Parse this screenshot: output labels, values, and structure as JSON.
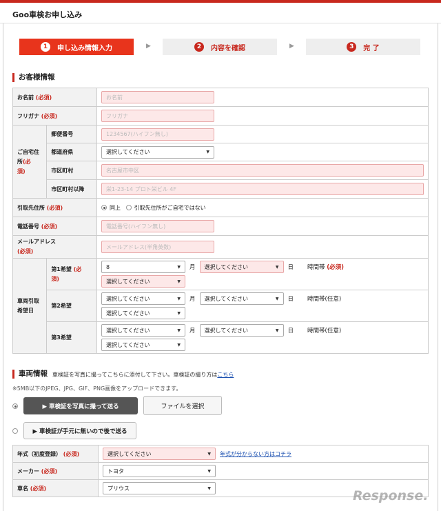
{
  "header": {
    "title": "Goo車検お申し込み"
  },
  "steps": [
    {
      "num": "1",
      "label": "申し込み情報入力"
    },
    {
      "num": "2",
      "label": "内容を確認"
    },
    {
      "num": "3",
      "label": "完 了"
    }
  ],
  "customer": {
    "section_title": "お客様情報",
    "required": "(必須)",
    "name": {
      "label": "お名前",
      "placeholder": "お名前"
    },
    "furigana": {
      "label": "フリガナ",
      "placeholder": "フリガナ"
    },
    "address": {
      "label": "ご自宅住所",
      "required_line1": "(必",
      "required_line2": "須)",
      "postal": {
        "label": "郵便番号",
        "placeholder": "1234567(ハイフン無し)"
      },
      "prefecture": {
        "label": "都道府県",
        "value": "選択してください"
      },
      "city": {
        "label": "市区町村",
        "placeholder": "名古屋市中区"
      },
      "street": {
        "label": "市区町村以降",
        "placeholder": "栄1-23-14 プロト栄ビル 4F"
      }
    },
    "pickup": {
      "label": "引取先住所",
      "option_same": "同上",
      "option_other": "引取先住所がご自宅ではない"
    },
    "phone": {
      "label": "電話番号",
      "placeholder": "電話番号(ハイフン無し)"
    },
    "email": {
      "label": "メールアドレス",
      "required": "(必須)",
      "placeholder": "メールアドレス(半角英数)"
    },
    "pickup_date": {
      "label_line1": "車両引取",
      "label_line2": "希望日",
      "month_unit": "月",
      "day_unit": "日",
      "first": {
        "label": "第1希望",
        "required_a": "(必",
        "required_b": "須)",
        "month": "8",
        "day": "選択してください",
        "time_label": "時間帯",
        "time_req": "(必須)",
        "time": "選択してください"
      },
      "second": {
        "label": "第2希望",
        "month": "選択してください",
        "day": "選択してください",
        "time_label": "時間帯(任意)",
        "time": "選択してください"
      },
      "third": {
        "label": "第3希望",
        "month": "選択してください",
        "day": "選択してください",
        "time_label": "時間帯(任意)",
        "time": "選択してください"
      }
    }
  },
  "vehicle": {
    "section_title": "車両情報",
    "description": "車検証を写真に撮ってこちらに添付して下さい。車検証の撮り方は",
    "description_link": "こちら",
    "note": "※5MB以下のJPEG、JPG、GIF、PNG画像をアップロードできます。",
    "photo_button": "▶ 車検証を写真に撮って送る",
    "file_button": "ファイルを選択",
    "later_button": "▶ 車検証が手元に無いので後で送る",
    "year": {
      "label": "年式（初度登録）",
      "required": "(必須)",
      "value": "選択してください",
      "help_link": "年式が分からない方はコチラ"
    },
    "maker": {
      "label": "メーカー",
      "required": "(必須)",
      "value": "トヨタ"
    },
    "model": {
      "label": "車名",
      "required": "(必須)",
      "value": "プリウス"
    }
  },
  "watermark": "Response."
}
